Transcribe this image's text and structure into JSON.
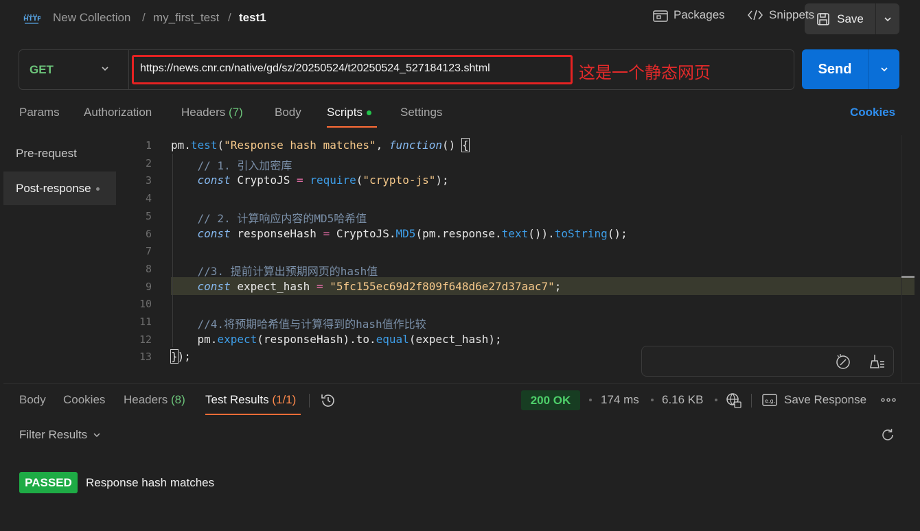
{
  "breadcrumb": {
    "collection": "New Collection",
    "folder": "my_first_test",
    "request": "test1",
    "separator": "/"
  },
  "save": {
    "label": "Save"
  },
  "request": {
    "method": "GET",
    "url": "https://news.cnr.cn/native/gd/sz/20250524/t20250524_527184123.shtml",
    "annotation": "这是一个静态网页"
  },
  "send": {
    "label": "Send"
  },
  "request_tabs": [
    {
      "label": "Params",
      "count": ""
    },
    {
      "label": "Authorization",
      "count": ""
    },
    {
      "label": "Headers",
      "count": "(7)"
    },
    {
      "label": "Body",
      "count": ""
    },
    {
      "label": "Scripts",
      "count": ""
    },
    {
      "label": "Settings",
      "count": ""
    }
  ],
  "cookies_link": "Cookies",
  "script_nav": {
    "pre": "Pre-request",
    "post": "Post-response"
  },
  "editor": {
    "line_numbers": [
      "1",
      "2",
      "3",
      "4",
      "5",
      "6",
      "7",
      "8",
      "9",
      "10",
      "11",
      "12",
      "13"
    ],
    "lines": [
      [
        [
          "id",
          "pm."
        ],
        [
          "fn",
          "test"
        ],
        [
          "br",
          "("
        ],
        [
          "str",
          "\"Response hash matches\""
        ],
        [
          "id",
          ", "
        ],
        [
          "kw",
          "function"
        ],
        [
          "br",
          "() "
        ],
        [
          "cur",
          "{"
        ]
      ],
      [
        [
          "cm",
          "    // 1. 引入加密库"
        ]
      ],
      [
        [
          "id",
          "    "
        ],
        [
          "kw",
          "const"
        ],
        [
          "id",
          " CryptoJS "
        ],
        [
          "op",
          "="
        ],
        [
          "id",
          " "
        ],
        [
          "fn",
          "require"
        ],
        [
          "br",
          "("
        ],
        [
          "str",
          "\"crypto-js\""
        ],
        [
          "br",
          ");"
        ]
      ],
      [],
      [
        [
          "cm",
          "    // 2. 计算响应内容的MD5哈希值"
        ]
      ],
      [
        [
          "id",
          "    "
        ],
        [
          "kw",
          "const"
        ],
        [
          "id",
          " responseHash "
        ],
        [
          "op",
          "="
        ],
        [
          "id",
          " CryptoJS."
        ],
        [
          "fn",
          "MD5"
        ],
        [
          "br",
          "("
        ],
        [
          "id",
          "pm.response."
        ],
        [
          "fn",
          "text"
        ],
        [
          "br",
          "())."
        ],
        [
          "fn",
          "toString"
        ],
        [
          "br",
          "();"
        ]
      ],
      [],
      [
        [
          "cm",
          "    //3. 提前计算出预期网页的hash值"
        ]
      ],
      [
        [
          "id",
          "    "
        ],
        [
          "kw",
          "const"
        ],
        [
          "id",
          " expect_hash "
        ],
        [
          "op",
          "="
        ],
        [
          "id",
          " "
        ],
        [
          "str",
          "\"5fc155ec69d2f809f648d6e27d37aac7\""
        ],
        [
          "br",
          ";"
        ]
      ],
      [],
      [
        [
          "cm",
          "    //4.将预期哈希值与计算得到的hash值作比较"
        ]
      ],
      [
        [
          "id",
          "    pm."
        ],
        [
          "fn",
          "expect"
        ],
        [
          "br",
          "("
        ],
        [
          "id",
          "responseHash"
        ],
        [
          "br",
          ")."
        ],
        [
          "id",
          "to."
        ],
        [
          "fn",
          "equal"
        ],
        [
          "br",
          "("
        ],
        [
          "id",
          "expect_hash"
        ],
        [
          "br",
          ");"
        ]
      ],
      [
        [
          "cur",
          "}"
        ],
        [
          "br",
          ");"
        ]
      ]
    ]
  },
  "editor_toolbar": {
    "packages": "Packages",
    "snippets": "Snippets"
  },
  "response_tabs": [
    {
      "label": "Body",
      "count": ""
    },
    {
      "label": "Cookies",
      "count": ""
    },
    {
      "label": "Headers",
      "count": "(8)"
    },
    {
      "label": "Test Results",
      "count": "(1/1)"
    }
  ],
  "response_meta": {
    "status": "200 OK",
    "time": "174 ms",
    "size": "6.16 KB",
    "save_response": "Save Response"
  },
  "filter_results": "Filter Results",
  "test_result": {
    "badge": "PASSED",
    "name": "Response hash matches"
  },
  "colors": {
    "accent_orange": "#ff6c37",
    "send_blue": "#0a6fd8",
    "pass_green": "#1eab45",
    "annotation_red": "#e52222"
  }
}
